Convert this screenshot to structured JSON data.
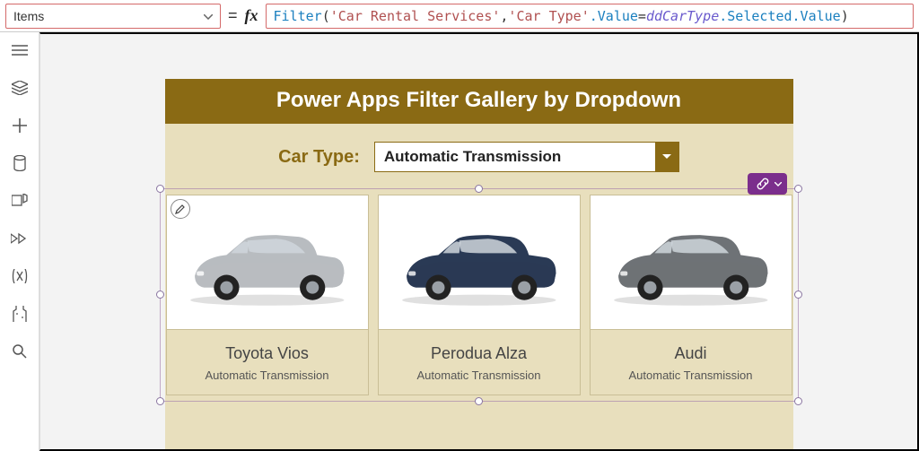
{
  "property_selector": {
    "value": "Items"
  },
  "formula": {
    "func": "Filter",
    "arg1": "'Car Rental Services'",
    "arg2_left": "'Car Type'",
    "arg2_prop": ".Value",
    "op": "=",
    "var": "ddCarType",
    "var_tail": ".Selected.Value"
  },
  "app": {
    "title": "Power Apps Filter Gallery by Dropdown",
    "filter_label": "Car Type:",
    "dropdown_value": "Automatic Transmission"
  },
  "gallery": {
    "items": [
      {
        "title": "Toyota Vios",
        "subtitle": "Automatic Transmission",
        "color": "#b8bcc0"
      },
      {
        "title": "Perodua Alza",
        "subtitle": "Automatic Transmission",
        "color": "#2a3a55"
      },
      {
        "title": "Audi",
        "subtitle": "Automatic Transmission",
        "color": "#6e7276"
      }
    ]
  },
  "icons": {
    "fx": "fx",
    "equals": "="
  }
}
